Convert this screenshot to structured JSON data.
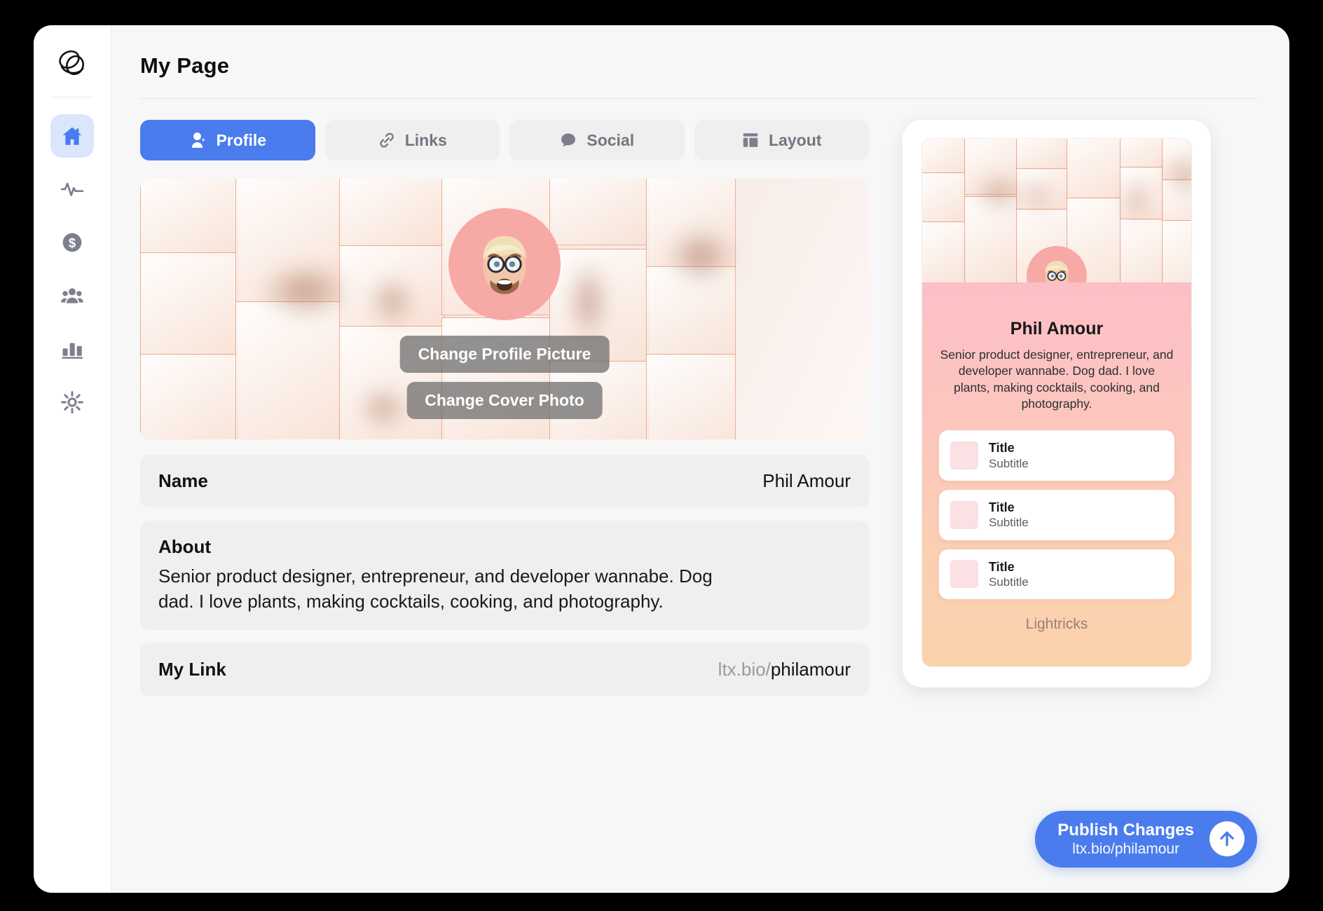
{
  "app": {
    "page_title": "My Page",
    "brand_icon": "lightricks-logo-icon",
    "accent_color": "#4a7ced",
    "tab_inactive_bg": "#efefef",
    "tab_inactive_text": "#74757f"
  },
  "sidebar": {
    "items": [
      {
        "icon": "home-icon",
        "name": "home",
        "active": true
      },
      {
        "icon": "activity-pulse-icon",
        "name": "activity",
        "active": false
      },
      {
        "icon": "dollar-coin-icon",
        "name": "earnings",
        "active": false
      },
      {
        "icon": "people-group-icon",
        "name": "audience",
        "active": false
      },
      {
        "icon": "bar-chart-icon",
        "name": "analytics",
        "active": false
      },
      {
        "icon": "gear-icon",
        "name": "settings",
        "active": false
      }
    ]
  },
  "tabs": [
    {
      "label": "Profile",
      "icon": "person-icon",
      "active": true
    },
    {
      "label": "Links",
      "icon": "link-chain-icon",
      "active": false
    },
    {
      "label": "Social",
      "icon": "speech-bubble-icon",
      "active": false
    },
    {
      "label": "Layout",
      "icon": "layout-grid-icon",
      "active": false
    }
  ],
  "cover": {
    "change_profile_picture": "Change Profile Picture",
    "change_cover_photo": "Change Cover Photo",
    "avatar_icon": "memoji-avatar",
    "avatar_bg": "#f7a9a6"
  },
  "fields": {
    "name": {
      "label": "Name",
      "value": "Phil Amour"
    },
    "about": {
      "label": "About",
      "value": "Senior product designer, entrepreneur, and developer wannabe. Dog dad. I love plants, making cocktails, cooking, and photography."
    },
    "link": {
      "label": "My Link",
      "domain": "ltx.bio/",
      "slug": "philamour"
    }
  },
  "preview": {
    "name": "Phil Amour",
    "bio": "Senior product designer, entrepreneur, and developer wannabe. Dog dad. I love plants, making cocktails, cooking, and photography.",
    "cards": [
      {
        "title": "Title",
        "subtitle": "Subtitle"
      },
      {
        "title": "Title",
        "subtitle": "Subtitle"
      },
      {
        "title": "Title",
        "subtitle": "Subtitle"
      }
    ],
    "footer": "Lightricks",
    "gradient_top": "#fcb4ca",
    "gradient_bottom": "#fcd2ad"
  },
  "publish": {
    "title": "Publish Changes",
    "subtitle": "ltx.bio/philamour",
    "icon": "arrow-up-circle-icon"
  }
}
